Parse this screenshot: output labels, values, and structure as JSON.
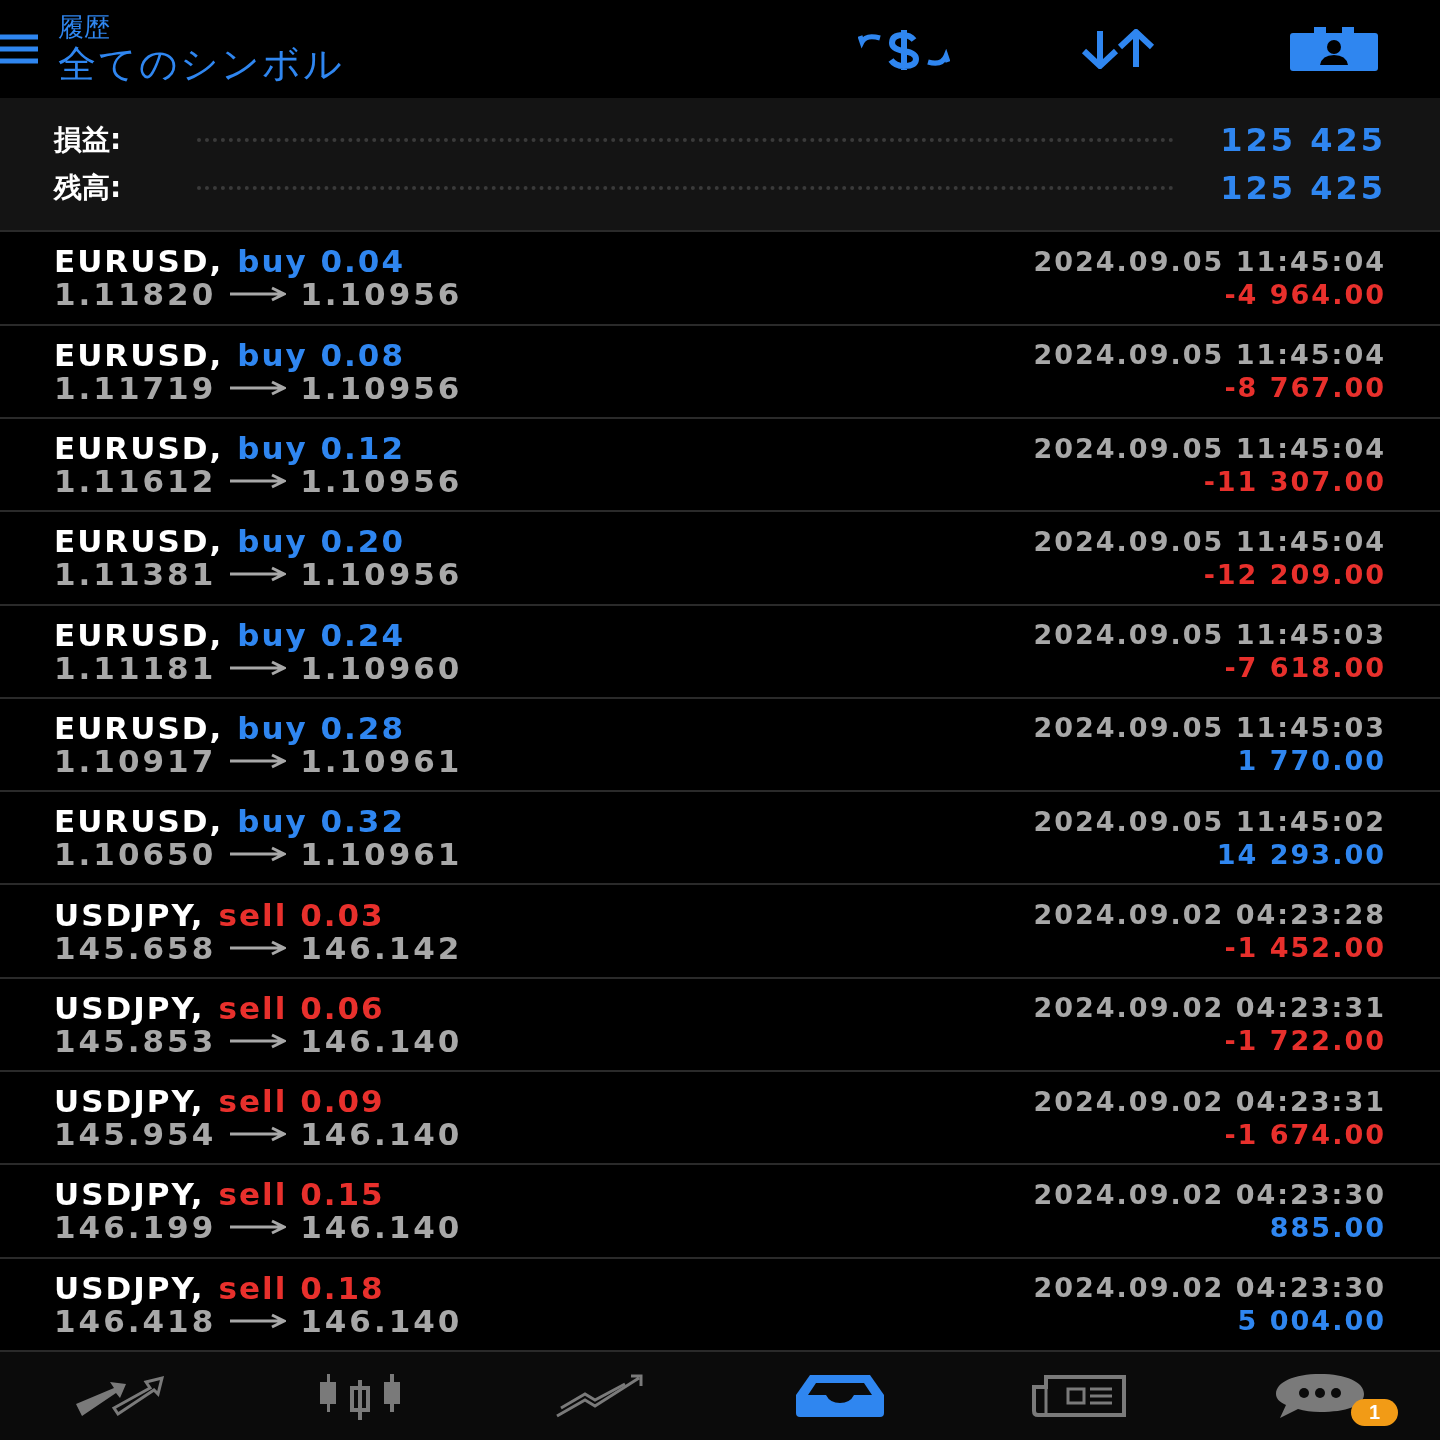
{
  "header": {
    "subtitle": "履歴",
    "title": "全てのシンボル"
  },
  "summary": [
    {
      "label": "損益:",
      "value": "125 425"
    },
    {
      "label": "残高:",
      "value": "125 425"
    }
  ],
  "deals": [
    {
      "symbol": "EURUSD,",
      "side": "buy",
      "kind": "buy",
      "volume": "0.04",
      "open": "1.11820",
      "close": "1.10956",
      "time": "2024.09.05 11:45:04",
      "profit": "-4 964.00",
      "loss": true
    },
    {
      "symbol": "EURUSD,",
      "side": "buy",
      "kind": "buy",
      "volume": "0.08",
      "open": "1.11719",
      "close": "1.10956",
      "time": "2024.09.05 11:45:04",
      "profit": "-8 767.00",
      "loss": true
    },
    {
      "symbol": "EURUSD,",
      "side": "buy",
      "kind": "buy",
      "volume": "0.12",
      "open": "1.11612",
      "close": "1.10956",
      "time": "2024.09.05 11:45:04",
      "profit": "-11 307.00",
      "loss": true
    },
    {
      "symbol": "EURUSD,",
      "side": "buy",
      "kind": "buy",
      "volume": "0.20",
      "open": "1.11381",
      "close": "1.10956",
      "time": "2024.09.05 11:45:04",
      "profit": "-12 209.00",
      "loss": true
    },
    {
      "symbol": "EURUSD,",
      "side": "buy",
      "kind": "buy",
      "volume": "0.24",
      "open": "1.11181",
      "close": "1.10960",
      "time": "2024.09.05 11:45:03",
      "profit": "-7 618.00",
      "loss": true
    },
    {
      "symbol": "EURUSD,",
      "side": "buy",
      "kind": "buy",
      "volume": "0.28",
      "open": "1.10917",
      "close": "1.10961",
      "time": "2024.09.05 11:45:03",
      "profit": "1 770.00",
      "loss": false
    },
    {
      "symbol": "EURUSD,",
      "side": "buy",
      "kind": "buy",
      "volume": "0.32",
      "open": "1.10650",
      "close": "1.10961",
      "time": "2024.09.05 11:45:02",
      "profit": "14 293.00",
      "loss": false
    },
    {
      "symbol": "USDJPY,",
      "side": "sell",
      "kind": "sell",
      "volume": "0.03",
      "open": "145.658",
      "close": "146.142",
      "time": "2024.09.02 04:23:28",
      "profit": "-1 452.00",
      "loss": true
    },
    {
      "symbol": "USDJPY,",
      "side": "sell",
      "kind": "sell",
      "volume": "0.06",
      "open": "145.853",
      "close": "146.140",
      "time": "2024.09.02 04:23:31",
      "profit": "-1 722.00",
      "loss": true
    },
    {
      "symbol": "USDJPY,",
      "side": "sell",
      "kind": "sell",
      "volume": "0.09",
      "open": "145.954",
      "close": "146.140",
      "time": "2024.09.02 04:23:31",
      "profit": "-1 674.00",
      "loss": true
    },
    {
      "symbol": "USDJPY,",
      "side": "sell",
      "kind": "sell",
      "volume": "0.15",
      "open": "146.199",
      "close": "146.140",
      "time": "2024.09.02 04:23:30",
      "profit": "885.00",
      "loss": false
    },
    {
      "symbol": "USDJPY,",
      "side": "sell",
      "kind": "sell",
      "volume": "0.18",
      "open": "146.418",
      "close": "146.140",
      "time": "2024.09.02 04:23:30",
      "profit": "5 004.00",
      "loss": false
    }
  ],
  "nav": [
    {
      "kind": "trade",
      "selected": false
    },
    {
      "kind": "quotes",
      "selected": false
    },
    {
      "kind": "chart",
      "selected": false
    },
    {
      "kind": "history",
      "selected": true
    },
    {
      "kind": "news",
      "selected": false
    },
    {
      "kind": "chat",
      "selected": false,
      "badge": "1"
    }
  ]
}
